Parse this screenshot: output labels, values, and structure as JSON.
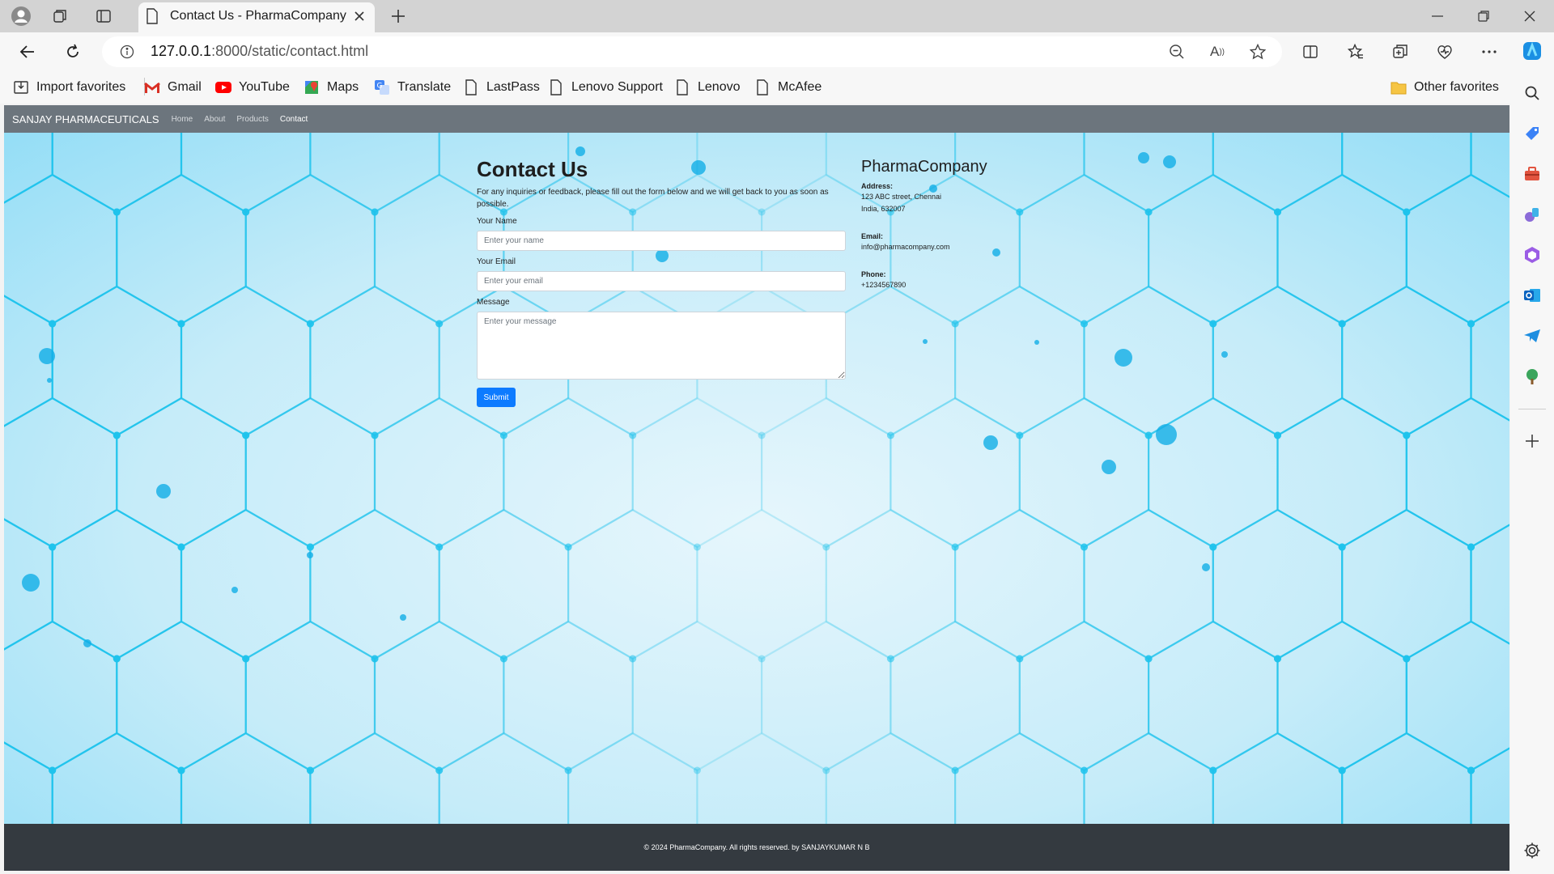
{
  "browser": {
    "tab_title": "Contact Us - PharmaCompany",
    "url_host": "127.0.0.1",
    "url_path": ":8000/static/contact.html",
    "bookmarks": [
      {
        "label": "Import favorites",
        "icon": "import-icon"
      },
      {
        "label": "Gmail",
        "icon": "gmail-icon"
      },
      {
        "label": "YouTube",
        "icon": "youtube-icon"
      },
      {
        "label": "Maps",
        "icon": "maps-icon"
      },
      {
        "label": "Translate",
        "icon": "translate-icon"
      },
      {
        "label": "LastPass",
        "icon": "page-icon"
      },
      {
        "label": "Lenovo Support",
        "icon": "page-icon"
      },
      {
        "label": "Lenovo",
        "icon": "page-icon"
      },
      {
        "label": "McAfee",
        "icon": "page-icon"
      }
    ],
    "other_favorites": "Other favorites"
  },
  "site": {
    "brand": "SANJAY PHARMACEUTICALS",
    "nav": [
      "Home",
      "About",
      "Products",
      "Contact"
    ],
    "active_nav": "Contact"
  },
  "contact": {
    "title": "Contact Us",
    "intro": "For any inquiries or feedback, please fill out the form below and we will get back to you as soon as possible.",
    "name_label": "Your Name",
    "name_placeholder": "Enter your name",
    "email_label": "Your Email",
    "email_placeholder": "Enter your email",
    "message_label": "Message",
    "message_placeholder": "Enter your message",
    "submit_label": "Submit"
  },
  "company": {
    "name": "PharmaCompany",
    "address_label": "Address:",
    "address_line1": "123 ABC street, Chennai",
    "address_line2": "India, 632007",
    "email_label": "Email:",
    "email": "info@pharmacompany.com",
    "phone_label": "Phone:",
    "phone": "+1234567890"
  },
  "footer": {
    "text": "© 2024 PharmaCompany. All rights reserved. by SANJAYKUMAR N B"
  },
  "colors": {
    "nav_bg": "#6c757d",
    "footer_bg": "#343a40",
    "submit_bg": "#0d7bff",
    "page_bg": "#cfeefa",
    "hex_line": "#1fc3ec"
  }
}
